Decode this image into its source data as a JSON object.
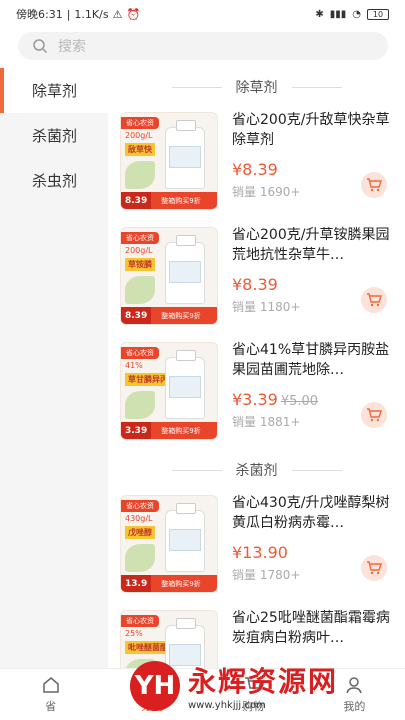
{
  "status": {
    "time": "傍晚6:31",
    "speed": "1.1K/s",
    "battery": "10"
  },
  "search": {
    "placeholder": "搜索"
  },
  "sidebar": {
    "items": [
      {
        "label": "除草剂"
      },
      {
        "label": "杀菌剂"
      },
      {
        "label": "杀虫剂"
      }
    ]
  },
  "sections": [
    {
      "title": "除草剂",
      "products": [
        {
          "title": "省心200克/升敌草快杂草除草剂",
          "price": "¥8.39",
          "old_price": "",
          "sales": "销量 1690+",
          "img_tag": "省心农资",
          "img_spec": "200g/L",
          "img_name": "敌草快",
          "img_price": "8.39",
          "img_bar": "整箱购买9折"
        },
        {
          "title": "省心200克/升草铵膦果园荒地抗性杂草牛…",
          "price": "¥8.39",
          "old_price": "",
          "sales": "销量 1180+",
          "img_tag": "省心农资",
          "img_spec": "200g/L",
          "img_name": "草铵膦",
          "img_price": "8.39",
          "img_bar": "整箱购买9折"
        },
        {
          "title": "省心41%草甘膦异丙胺盐果园苗圃荒地除…",
          "price": "¥3.39",
          "old_price": "¥5.00",
          "sales": "销量 1881+",
          "img_tag": "省心农资",
          "img_spec": "41%",
          "img_name": "草甘膦异丙胺盐",
          "img_price": "3.39",
          "img_bar": "整箱购买9折"
        }
      ]
    },
    {
      "title": "杀菌剂",
      "products": [
        {
          "title": "省心430克/升戊唑醇梨树黄瓜白粉病赤霉…",
          "price": "¥13.90",
          "old_price": "",
          "sales": "销量 1780+",
          "img_tag": "省心农资",
          "img_spec": "430g/L",
          "img_name": "戊唑醇",
          "img_price": "13.9",
          "img_bar": "整箱购买9折"
        },
        {
          "title": "省心25吡唑醚菌酯霜霉病炭疽病白粉病叶…",
          "price": "",
          "old_price": "",
          "sales": "",
          "img_tag": "省心农资",
          "img_spec": "25%",
          "img_name": "吡唑醚菌酯",
          "img_price": "",
          "img_bar": ""
        }
      ]
    }
  ],
  "bottomnav": {
    "items": [
      {
        "label": "省",
        "icon": "home-icon"
      },
      {
        "label": "分类",
        "icon": "category-icon"
      },
      {
        "label": "购物",
        "icon": "cart-icon"
      },
      {
        "label": "我的",
        "icon": "user-icon"
      }
    ]
  },
  "watermark": {
    "logo": "YH",
    "text": "永辉资源网",
    "url": "www.yhkjjj.com"
  },
  "colors": {
    "accent": "#ee6a3c",
    "price": "#ee5a36"
  }
}
